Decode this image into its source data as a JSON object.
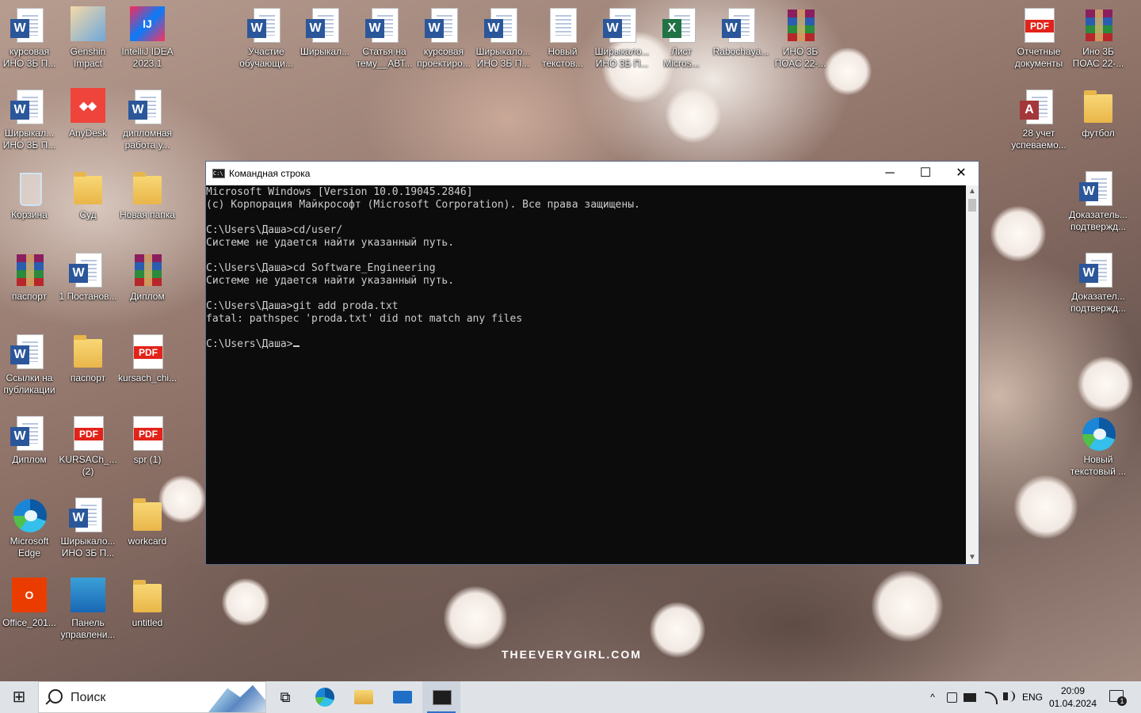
{
  "wallpaper": {
    "watermark": "THEEVERYGIRL.COM"
  },
  "desktop": {
    "icons": [
      {
        "label": "курсовая ИНО 3Б П...",
        "type": "word"
      },
      {
        "label": "Genshin Impact",
        "type": "app"
      },
      {
        "label": "IntelliJ IDEA 2023.1",
        "type": "app"
      },
      {
        "label": "Участие обучающи...",
        "type": "word"
      },
      {
        "label": "Ширыкал...",
        "type": "word"
      },
      {
        "label": "Статья на тему__АВТ...",
        "type": "word"
      },
      {
        "label": "курсовая проектиро...",
        "type": "word"
      },
      {
        "label": "Ширыкало... ИНО 3Б П...",
        "type": "word"
      },
      {
        "label": "Новый текстов...",
        "type": "text"
      },
      {
        "label": "Ширыкало... ИНО 3Б П...",
        "type": "word"
      },
      {
        "label": "Лист Micros...",
        "type": "excel"
      },
      {
        "label": "Rabochaya...",
        "type": "word"
      },
      {
        "label": "ИНО 3Б ПОАС 22-...",
        "type": "rar"
      },
      {
        "label": "Отчетные документы",
        "type": "pdf"
      },
      {
        "label": "Ино 3Б ПОАС 22-...",
        "type": "rar"
      },
      {
        "label": "Ширыкал... ИНО 3Б П...",
        "type": "word"
      },
      {
        "label": "AnyDesk",
        "type": "app"
      },
      {
        "label": "дипломная работа у...",
        "type": "word"
      },
      {
        "label": "28 учет успеваемо...",
        "type": "access"
      },
      {
        "label": "футбол",
        "type": "folder"
      },
      {
        "label": "Корзина",
        "type": "bin"
      },
      {
        "label": "Суд",
        "type": "folder"
      },
      {
        "label": "Новая папка",
        "type": "folder"
      },
      {
        "label": "Доказатель... подтвержд...",
        "type": "word"
      },
      {
        "label": "паспорт",
        "type": "rar"
      },
      {
        "label": "1 Постанов...",
        "type": "word"
      },
      {
        "label": "Диплом",
        "type": "rar"
      },
      {
        "label": "Доказател... подтвержд...",
        "type": "word"
      },
      {
        "label": "Ссылки на публикации",
        "type": "word"
      },
      {
        "label": "паспорт",
        "type": "folder"
      },
      {
        "label": "kursach_chi...",
        "type": "pdf"
      },
      {
        "label": "Диплом",
        "type": "word"
      },
      {
        "label": "KURSACh_... (2)",
        "type": "pdf"
      },
      {
        "label": "spr (1)",
        "type": "pdf"
      },
      {
        "label": "Новый текстовый ...",
        "type": "edge"
      },
      {
        "label": "Microsoft Edge",
        "type": "edge"
      },
      {
        "label": "Ширыкало... ИНО 3Б П...",
        "type": "word"
      },
      {
        "label": "workcard",
        "type": "folder"
      },
      {
        "label": "Office_201...",
        "type": "app"
      },
      {
        "label": "Панель управлени...",
        "type": "app"
      },
      {
        "label": "untitled",
        "type": "folder"
      }
    ],
    "badges": {
      "word": "W",
      "excel": "X",
      "access": "A",
      "pdf": "PDF",
      "intellij": "IJ",
      "anydesk": "◆◆",
      "office": "O"
    }
  },
  "console": {
    "title": "Командная строка",
    "controls": {
      "minimize": "─",
      "maximize": "☐",
      "close": "✕"
    },
    "scroll_up": "▲",
    "scroll_down": "▼",
    "icon_text": "C:\\",
    "lines": [
      "Microsoft Windows [Version 10.0.19045.2846]",
      "(c) Корпорация Майкрософт (Microsoft Corporation). Все права защищены.",
      "",
      "C:\\Users\\Даша>cd/user/",
      "Системе не удается найти указанный путь.",
      "",
      "C:\\Users\\Даша>cd Software_Engineering",
      "Системе не удается найти указанный путь.",
      "",
      "C:\\Users\\Даша>git add proda.txt",
      "fatal: pathspec 'proda.txt' did not match any files",
      "",
      "C:\\Users\\Даша>"
    ]
  },
  "taskbar": {
    "start_glyph": "⊞",
    "search_placeholder": "Поиск",
    "task_view_glyph": "⧉",
    "apps": [
      "edge",
      "file-explorer",
      "mail",
      "command-prompt"
    ],
    "tray": {
      "chevron": "^",
      "language": "ENG",
      "time": "20:09",
      "date": "01.04.2024",
      "notifications_count": "1"
    }
  }
}
